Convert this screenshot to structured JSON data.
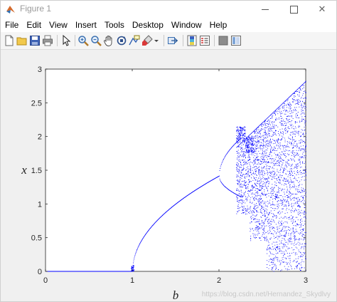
{
  "window": {
    "title": "Figure 1"
  },
  "menu": [
    "File",
    "Edit",
    "View",
    "Insert",
    "Tools",
    "Desktop",
    "Window",
    "Help"
  ],
  "toolbar_icons": [
    "new-figure-icon",
    "open-file-icon",
    "save-icon",
    "print-icon",
    "edit-plot-arrow-icon",
    "zoom-in-icon",
    "zoom-out-icon",
    "pan-hand-icon",
    "rotate-3d-icon",
    "data-cursor-icon",
    "brush-icon",
    "brush-dropdown-icon",
    "link-plot-icon",
    "insert-colorbar-icon",
    "insert-legend-icon",
    "hide-plot-tools-icon",
    "show-plot-tools-icon"
  ],
  "chart_data": {
    "type": "scatter",
    "xlabel": "b",
    "ylabel": "x",
    "xlim": [
      0,
      3
    ],
    "ylim": [
      0,
      3
    ],
    "xticks": [
      "0",
      "1",
      "2",
      "3"
    ],
    "yticks": [
      "0",
      "0.5",
      "1",
      "1.5",
      "2",
      "2.5",
      "3"
    ],
    "grid": false,
    "marker_color": "#0000ff",
    "fixed_point": "x = 0 for b < 1, x = sqrt(2*(b - 1)) for 1 <= b < 2",
    "period_doubling_b": 2.0,
    "chaos_onset_b": 2.25,
    "upper_envelope": {
      "b": [
        2.25,
        3.0
      ],
      "x": [
        1.9,
        2.82
      ]
    }
  },
  "watermark": "https://blog.csdn.net/Hernandez_Skydlvy"
}
